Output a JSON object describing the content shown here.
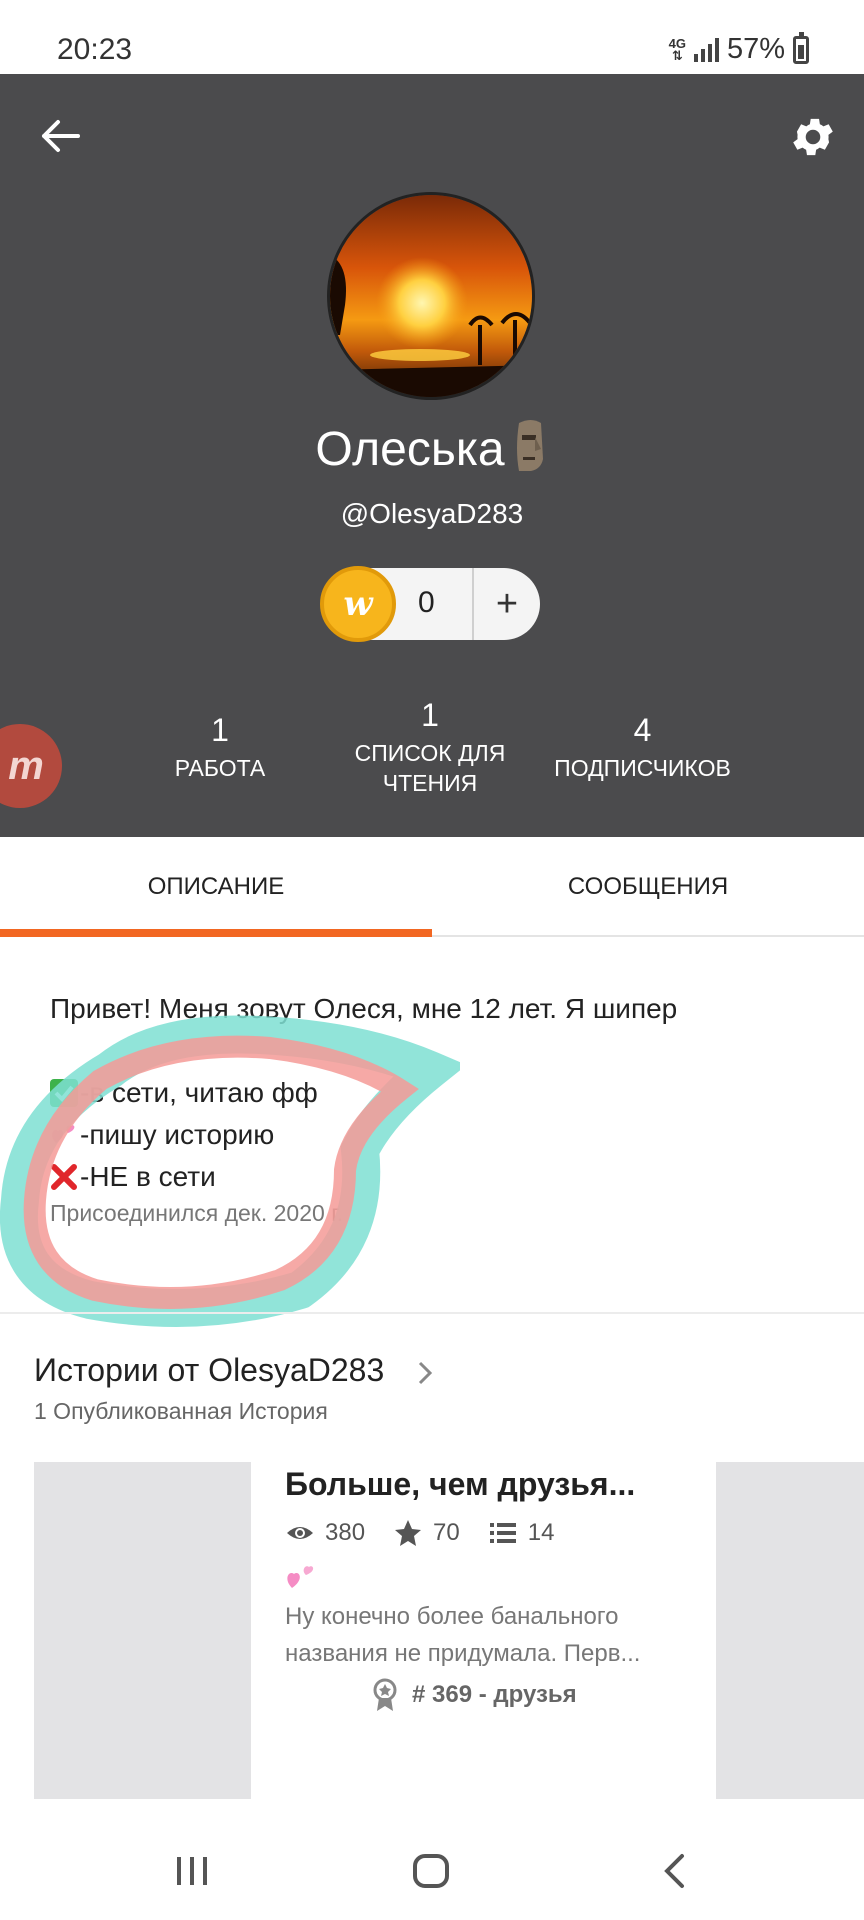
{
  "status_bar": {
    "time": "20:23",
    "network": "4G",
    "battery": "57%"
  },
  "profile": {
    "display_name": "Олеська",
    "username": "@OlesyaD283",
    "coins": "0"
  },
  "stats": {
    "works": {
      "value": "1",
      "label": "РАБОТА"
    },
    "reading_lists": {
      "value": "1",
      "label_line1": "СПИСОК ДЛЯ",
      "label_line2": "ЧТЕНИЯ"
    },
    "followers": {
      "value": "4",
      "label": "ПОДПИСЧИКОВ"
    }
  },
  "tabs": [
    {
      "label": "ОПИСАНИЕ",
      "active": true
    },
    {
      "label": "СООБЩЕНИЯ",
      "active": false
    }
  ],
  "about": {
    "line1": "Привет! Меня зовут Олеся, мне 12 лет. Я шипер",
    "line2": "-в сети, читаю фф",
    "line3": "-пишу историю",
    "line4": "-НЕ в сети",
    "joined": "Присоединился дек. 2020 г."
  },
  "stories": {
    "title": "Истории от OlesyaD283",
    "subtitle": "1 Опубликованная История",
    "items": [
      {
        "title": "Больше, чем друзья...",
        "reads": "380",
        "votes": "70",
        "parts": "14",
        "description_line1": "Ну конечно более банального",
        "description_line2": "названия не придумала. Перв...",
        "rank": "# 369 - друзья"
      }
    ]
  },
  "colors": {
    "header_bg": "#4b4b4d",
    "accent": "#f26722",
    "coin": "#f7b51c"
  }
}
